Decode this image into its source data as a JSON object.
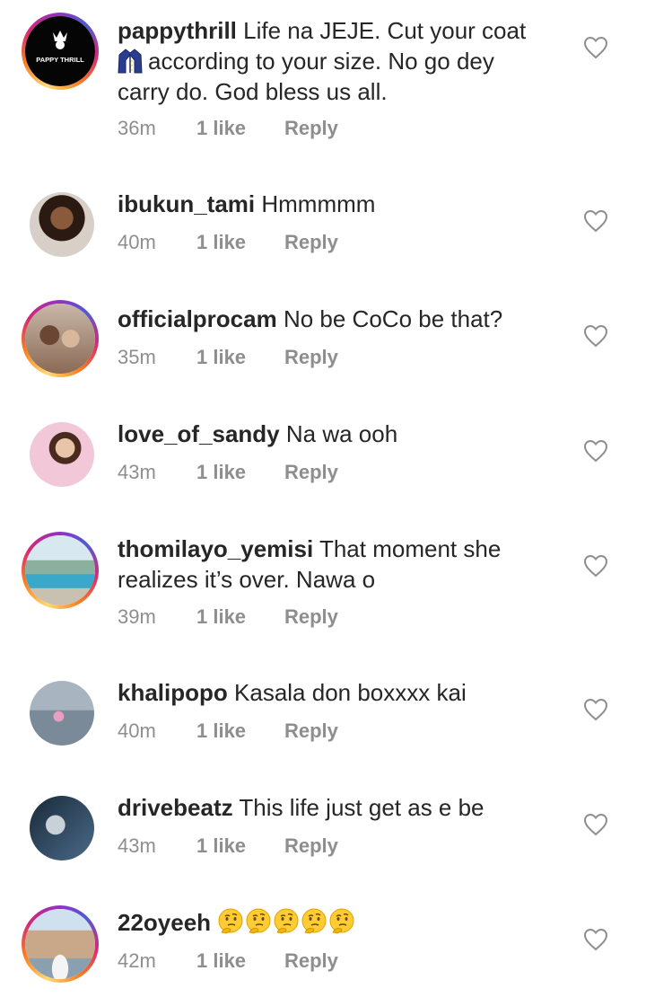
{
  "comments": [
    {
      "username": "pappythrill",
      "text_before": "Life na JEJE. Cut your coat",
      "text_after": "according to your size. No go dey carry do. God bless us all.",
      "inline_icon": "coat-emoji",
      "time": "36m",
      "likes": "1 like",
      "reply": "Reply",
      "avatar_text": "PAPPY THRILL",
      "story_ring": true
    },
    {
      "username": "ibukun_tami",
      "text": "Hmmmmm",
      "time": "40m",
      "likes": "1 like",
      "reply": "Reply",
      "story_ring": false
    },
    {
      "username": "officialprocam",
      "text": "No be CoCo be that?",
      "time": "35m",
      "likes": "1 like",
      "reply": "Reply",
      "story_ring": true
    },
    {
      "username": "love_of_sandy",
      "text": "Na wa ooh",
      "time": "43m",
      "likes": "1 like",
      "reply": "Reply",
      "story_ring": false
    },
    {
      "username": "thomilayo_yemisi",
      "text": "That moment she realizes it’s over. Nawa o",
      "time": "39m",
      "likes": "1 like",
      "reply": "Reply",
      "story_ring": true
    },
    {
      "username": "khalipopo",
      "text": "Kasala don boxxxx kai",
      "time": "40m",
      "likes": "1 like",
      "reply": "Reply",
      "story_ring": false
    },
    {
      "username": "drivebeatz",
      "text": "This life just get as e be",
      "time": "43m",
      "likes": "1 like",
      "reply": "Reply",
      "story_ring": false
    },
    {
      "username": "22oyeeh",
      "emoji_count": 5,
      "emoji": "thinking-face-emoji",
      "time": "42m",
      "likes": "1 like",
      "reply": "Reply",
      "story_ring": true
    }
  ],
  "icons": {
    "like": "heart-outline-icon"
  },
  "colors": {
    "text": "#262626",
    "meta": "#8e8e8e",
    "background": "#ffffff"
  }
}
